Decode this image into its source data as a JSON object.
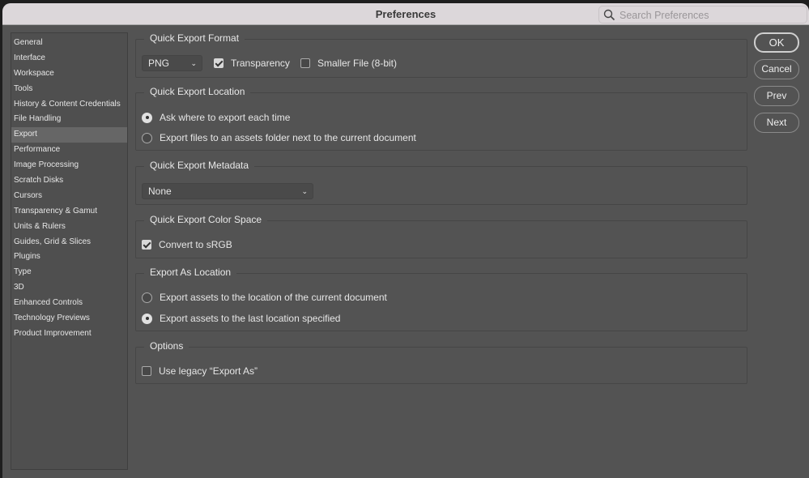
{
  "title": "Preferences",
  "search": {
    "placeholder": "Search Preferences",
    "icon": "search-icon"
  },
  "sidebar": {
    "selected": "Export",
    "items": [
      "General",
      "Interface",
      "Workspace",
      "Tools",
      "History & Content Credentials",
      "File Handling",
      "Export",
      "Performance",
      "Image Processing",
      "Scratch Disks",
      "Cursors",
      "Transparency & Gamut",
      "Units & Rulers",
      "Guides, Grid & Slices",
      "Plugins",
      "Type",
      "3D",
      "Enhanced Controls",
      "Technology Previews",
      "Product Improvement"
    ]
  },
  "buttons": {
    "ok": "OK",
    "cancel": "Cancel",
    "prev": "Prev",
    "next": "Next"
  },
  "format": {
    "label": "Quick Export Format",
    "select": "PNG",
    "transparency": "Transparency",
    "transparency_checked": true,
    "smaller": "Smaller File (8-bit)",
    "smaller_checked": false
  },
  "location": {
    "label": "Quick Export Location",
    "opt1": "Ask where to export each time",
    "opt2": "Export files to an assets folder next to the current document",
    "selected": 1
  },
  "metadata": {
    "label": "Quick Export Metadata",
    "select": "None"
  },
  "colorspace": {
    "label": "Quick Export Color Space",
    "convert": "Convert to sRGB",
    "checked": true
  },
  "exportas": {
    "label": "Export As Location",
    "opt1": "Export assets to the location of the current document",
    "opt2": "Export assets to the last location specified",
    "selected": 2
  },
  "options": {
    "label": "Options",
    "legacy": "Use legacy “Export As”",
    "checked": false
  }
}
